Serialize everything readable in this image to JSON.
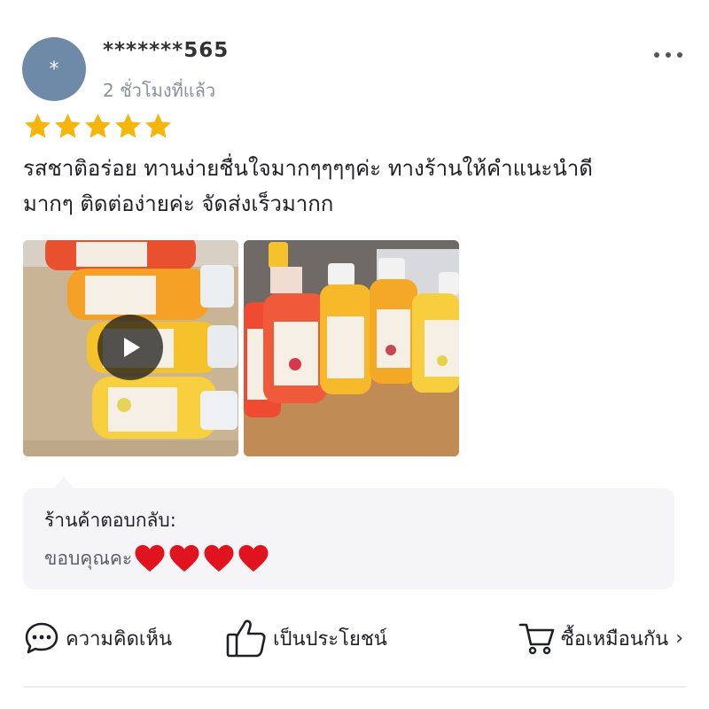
{
  "user": {
    "avatar_initial": "*",
    "name": "*******565",
    "time": "2 ชั่วโมงที่แล้ว"
  },
  "rating": {
    "stars": 5,
    "max": 5,
    "color": "#f5b50a"
  },
  "review": {
    "line1": "รสชาติอร่อย ทานง่ายชื่นใจมากๆๆๆๆค่ะ ทางร้านให้คำแนะนำดี",
    "line2": "มากๆ ติดต่อง่ายค่ะ จัดส่งเร็วมากก"
  },
  "media": [
    {
      "type": "video",
      "icon": "play-icon"
    },
    {
      "type": "image"
    }
  ],
  "seller_reply": {
    "title": "ร้านค้าตอบกลับ:",
    "text": "ขอบคุณคะ",
    "heart_count": 4,
    "heart_color": "#e0141e"
  },
  "actions": {
    "comment_label": "ความคิดเห็น",
    "helpful_label": "เป็นประโยชน์",
    "buy_label": "ซื้อเหมือนกัน"
  },
  "icons": {
    "more": "more-dots-icon",
    "comment": "chat-bubble-icon",
    "helpful": "thumbs-up-icon",
    "buy": "cart-icon",
    "chevron": "chevron-right-icon"
  }
}
